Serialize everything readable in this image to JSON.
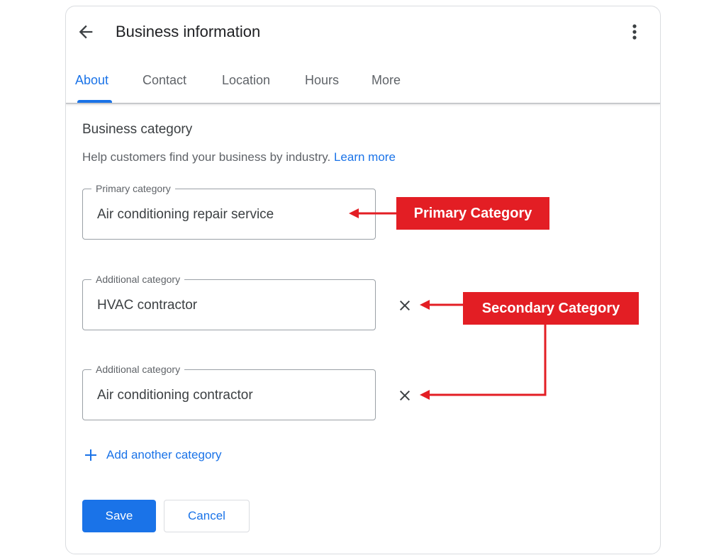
{
  "header": {
    "title": "Business information",
    "back_icon": "arrow-back-icon",
    "menu_icon": "more-vert-icon"
  },
  "tabs": [
    {
      "label": "About",
      "active": true
    },
    {
      "label": "Contact",
      "active": false
    },
    {
      "label": "Location",
      "active": false
    },
    {
      "label": "Hours",
      "active": false
    },
    {
      "label": "More",
      "active": false
    }
  ],
  "section": {
    "title": "Business category",
    "helper_text": "Help customers find your business by industry.",
    "learn_more": "Learn more"
  },
  "fields": [
    {
      "label": "Primary category",
      "value": "Air conditioning repair service"
    },
    {
      "label": "Additional category",
      "value": "HVAC contractor"
    },
    {
      "label": "Additional category",
      "value": "Air conditioning contractor"
    }
  ],
  "add_category": "Add another category",
  "actions": {
    "save": "Save",
    "cancel": "Cancel"
  },
  "annotations": {
    "primary": "Primary Category",
    "secondary": "Secondary Category",
    "color": "#e31e24"
  },
  "colors": {
    "accent": "#1a73e8",
    "annotation": "#e31e24"
  }
}
